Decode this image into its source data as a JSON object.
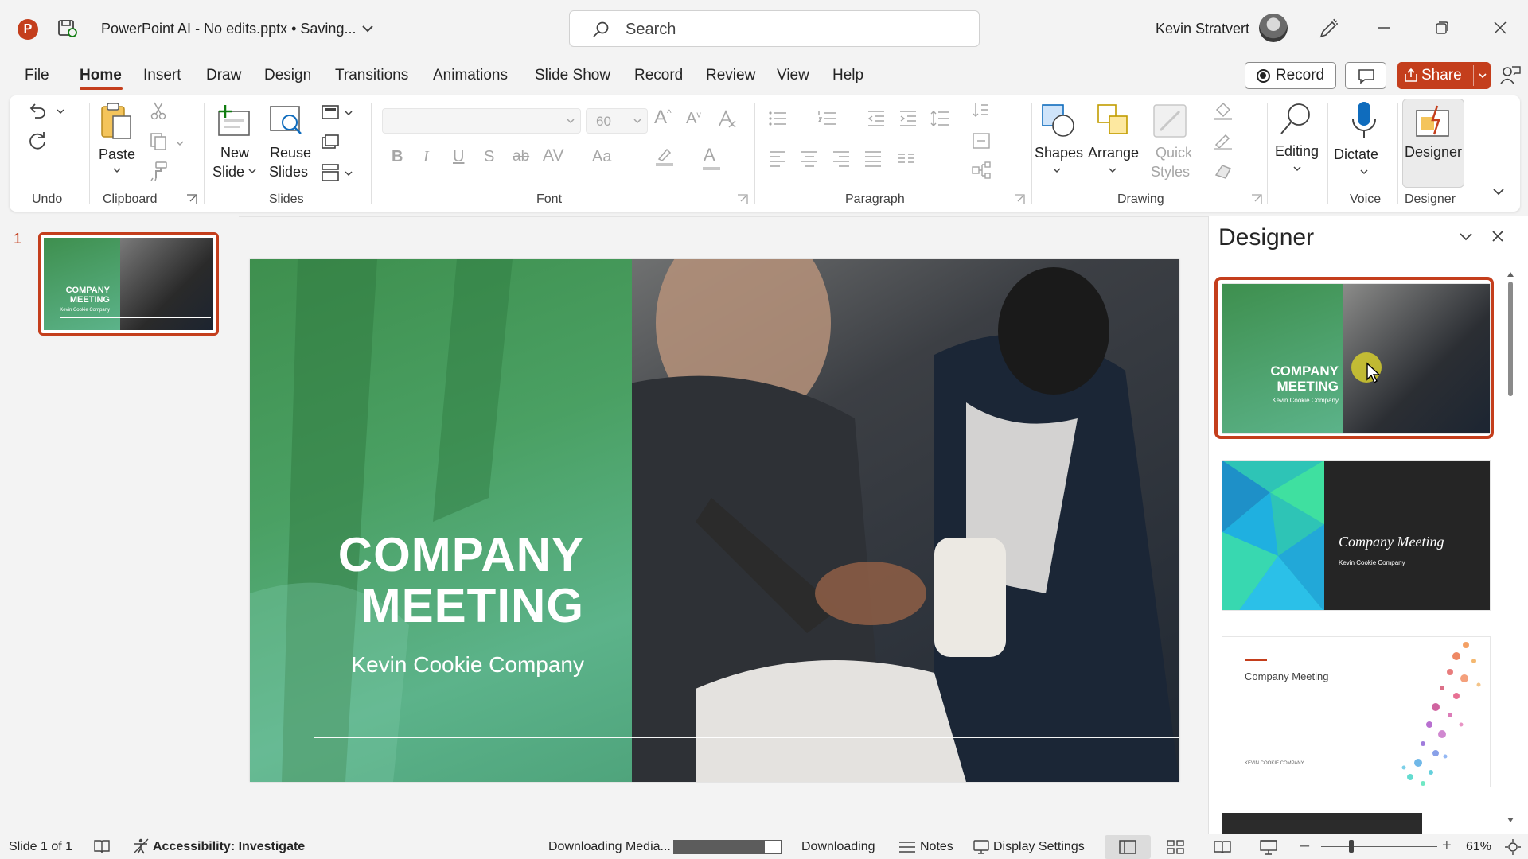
{
  "titlebar": {
    "app_logo_letter": "P",
    "doc_title": "PowerPoint AI - No edits.pptx • Saving...",
    "search_placeholder": "Search",
    "user_name": "Kevin Stratvert"
  },
  "tabs": [
    "File",
    "Home",
    "Insert",
    "Draw",
    "Design",
    "Transitions",
    "Animations",
    "Slide Show",
    "Record",
    "Review",
    "View",
    "Help"
  ],
  "active_tab": "Home",
  "actions": {
    "record_label": "Record",
    "share_label": "Share"
  },
  "ribbon": {
    "groups": {
      "undo": "Undo",
      "clipboard": "Clipboard",
      "slides": "Slides",
      "font": "Font",
      "paragraph": "Paragraph",
      "drawing": "Drawing",
      "voice": "Voice",
      "designer": "Designer"
    },
    "paste_label": "Paste",
    "new_slide_label_1": "New",
    "new_slide_label_2": "Slide",
    "reuse_label_1": "Reuse",
    "reuse_label_2": "Slides",
    "font_size": "60",
    "shapes_label": "Shapes",
    "arrange_label": "Arrange",
    "quick_styles_label_1": "Quick",
    "quick_styles_label_2": "Styles",
    "editing_label": "Editing",
    "dictate_label": "Dictate",
    "designer_label": "Designer",
    "font_buttons": [
      "B",
      "I",
      "U",
      "S",
      "ab",
      "AV",
      "Aa"
    ]
  },
  "thumbnails": {
    "slide_number": "1",
    "title": "COMPANY MEETING",
    "subtitle": "Kevin Cookie Company"
  },
  "slide": {
    "title_line1": "COMPANY",
    "title_line2": "MEETING",
    "subtitle": "Kevin Cookie Company"
  },
  "designer_pane": {
    "title": "Designer",
    "options": [
      {
        "title": "COMPANY MEETING",
        "subtitle": "Kevin Cookie Company",
        "selected": true
      },
      {
        "title": "Company Meeting",
        "subtitle": "Kevin Cookie Company",
        "selected": false
      },
      {
        "title": "Company Meeting",
        "subtitle": "KEVIN COOKIE COMPANY",
        "selected": false
      }
    ]
  },
  "statusbar": {
    "slide_indicator": "Slide 1 of 1",
    "accessibility": "Accessibility: Investigate",
    "downloading_media": "Downloading Media...",
    "download_progress": 0.85,
    "downloading": "Downloading",
    "notes": "Notes",
    "display_settings": "Display Settings",
    "zoom_minus": "–",
    "zoom_plus": "+",
    "zoom": "61%"
  },
  "colors": {
    "accent": "#c43e1c",
    "slide_green": "#4aa063"
  }
}
